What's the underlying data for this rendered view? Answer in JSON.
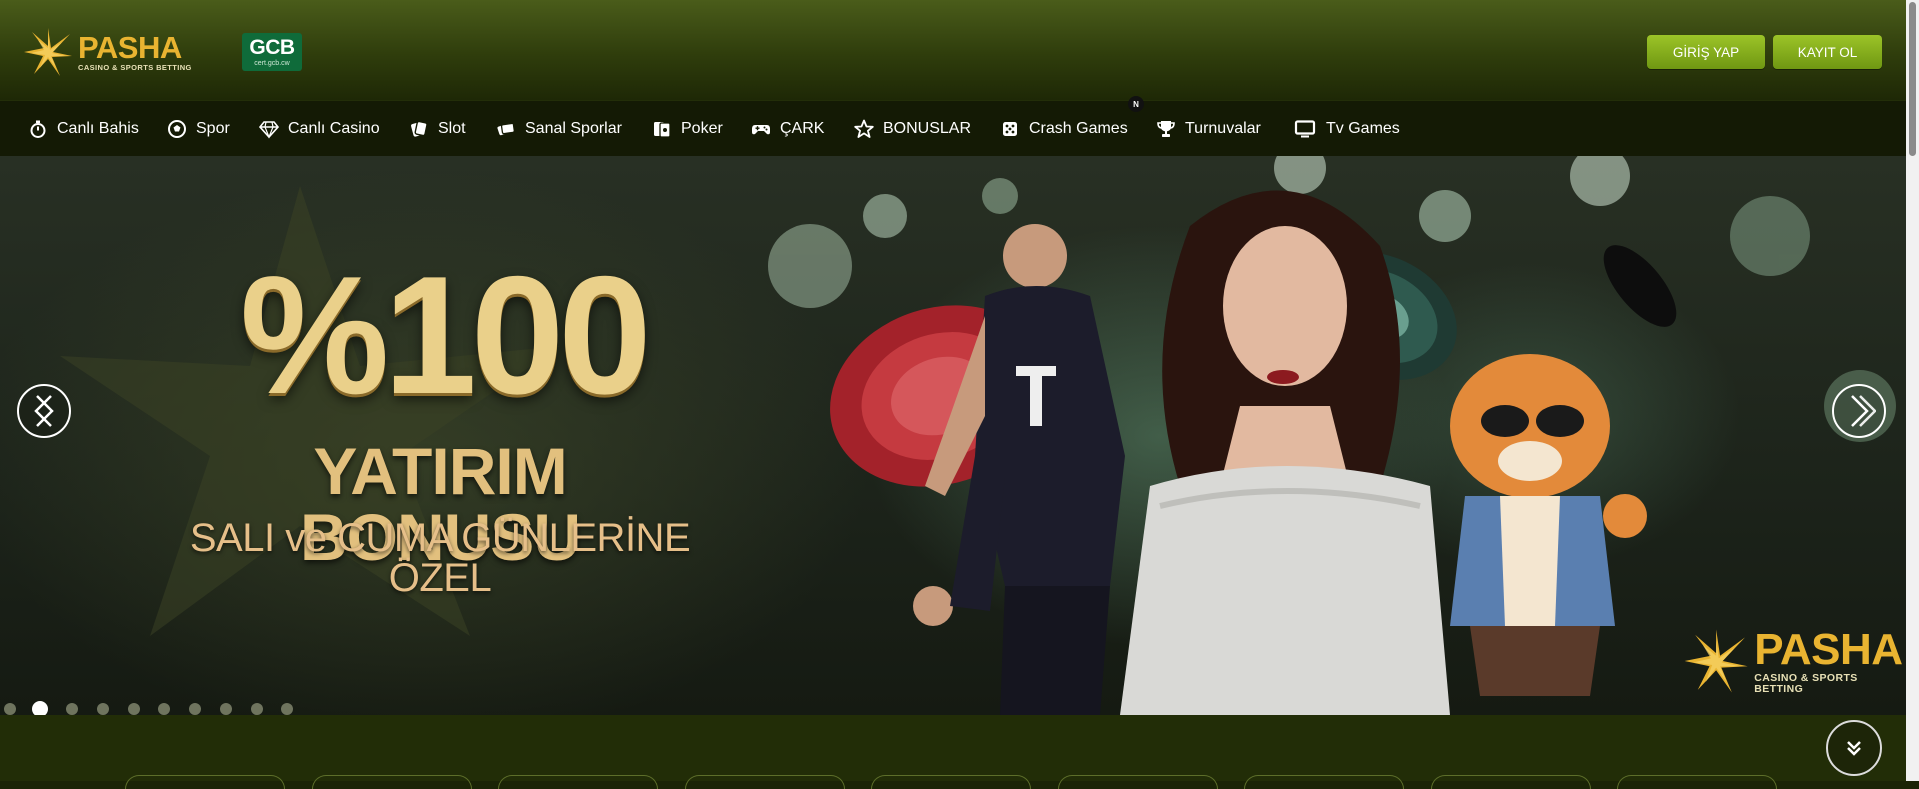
{
  "header": {
    "logo": {
      "name": "PASHA",
      "tagline": "CASINO & SPORTS BETTING"
    },
    "license_badge": {
      "title": "GCB",
      "subtitle": "cert.gcb.cw"
    },
    "login_label": "GİRİŞ YAP",
    "register_label": "KAYIT OL"
  },
  "nav": {
    "items": [
      {
        "label": "Canlı Bahis",
        "icon": "stopwatch-icon"
      },
      {
        "label": "Spor",
        "icon": "soccer-ball-icon"
      },
      {
        "label": "Canlı Casino",
        "icon": "diamond-icon"
      },
      {
        "label": "Slot",
        "icon": "cards-icon"
      },
      {
        "label": "Sanal Sporlar",
        "icon": "tickets-icon"
      },
      {
        "label": "Poker",
        "icon": "poker-cards-icon"
      },
      {
        "label": "ÇARK",
        "icon": "gamepad-icon"
      },
      {
        "label": "BONUSLAR",
        "icon": "star-icon"
      },
      {
        "label": "Crash Games",
        "icon": "dice-icon"
      },
      {
        "label": "Turnuvalar",
        "icon": "trophy-icon"
      },
      {
        "label": "Tv Games",
        "icon": "monitor-icon"
      }
    ],
    "new_badge": "N"
  },
  "hero": {
    "amount": "%100",
    "title": "YATIRIM BONUSU",
    "subtitle": "SALI ve CUMA GÜNLERİNE ÖZEL",
    "logo": {
      "name": "PASHA",
      "tagline": "CASINO & SPORTS BETTING"
    },
    "slide_count": 10,
    "active_slide": 2
  },
  "colors": {
    "brand_gold": "#e9b431",
    "button_green": "#8bb51f",
    "nav_bg": "#141a05",
    "header_bg": "#3a4a12"
  }
}
